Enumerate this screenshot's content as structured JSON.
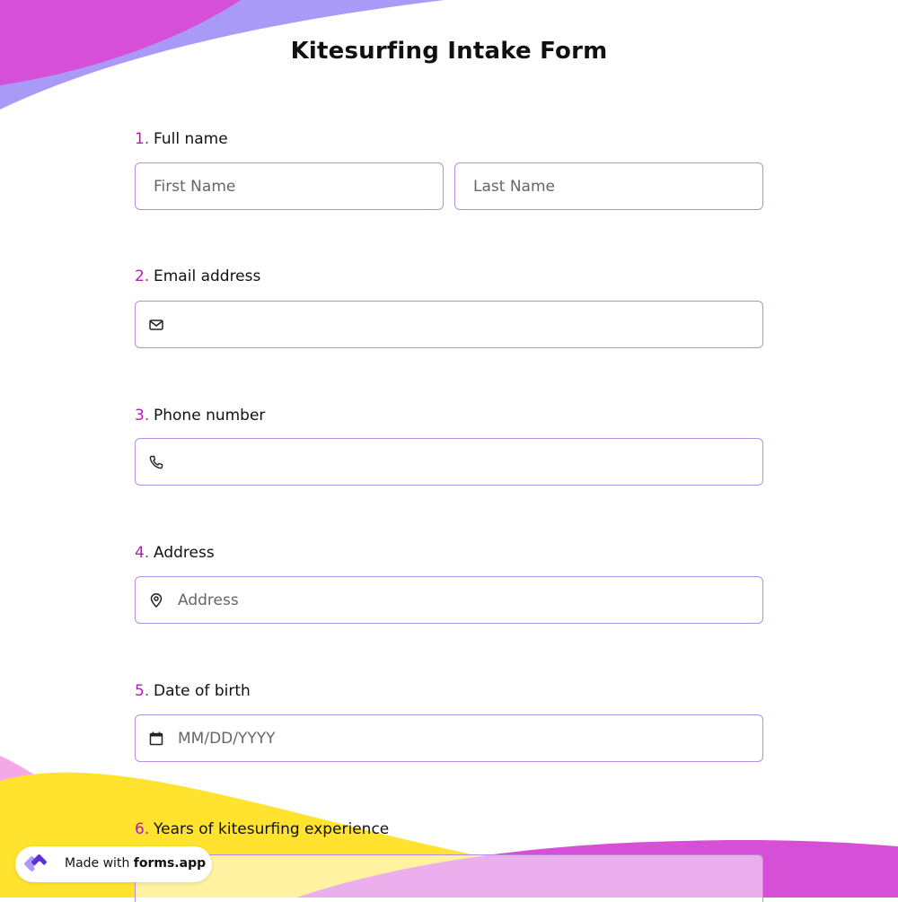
{
  "form": {
    "title": "Kitesurfing Intake Form",
    "questions": [
      {
        "number": "1.",
        "label": "Full name",
        "fields": [
          {
            "placeholder": "First Name",
            "icon": null
          },
          {
            "placeholder": "Last Name",
            "icon": null
          }
        ]
      },
      {
        "number": "2.",
        "label": "Email address",
        "fields": [
          {
            "placeholder": "",
            "icon": "envelope-icon"
          }
        ]
      },
      {
        "number": "3.",
        "label": "Phone number",
        "fields": [
          {
            "placeholder": "",
            "icon": "phone-icon"
          }
        ]
      },
      {
        "number": "4.",
        "label": "Address",
        "fields": [
          {
            "placeholder": "Address",
            "icon": "map-pin-icon"
          }
        ]
      },
      {
        "number": "5.",
        "label": "Date of birth",
        "fields": [
          {
            "placeholder": "MM/DD/YYYY",
            "icon": "calendar-icon"
          }
        ]
      },
      {
        "number": "6.",
        "label": "Years of kitesurfing experience",
        "fields": [
          {
            "placeholder": "",
            "icon": null
          }
        ]
      }
    ]
  },
  "badge": {
    "prefix": "Made with",
    "brand": "forms.app"
  },
  "colors": {
    "accent_number": "#b31bb8",
    "field_border": "#b58ee0",
    "blob_magenta": "#d64fd7",
    "blob_lavender": "#a99af7",
    "blob_yellow": "#ffe32e",
    "blob_pink": "#f4a8e6"
  }
}
